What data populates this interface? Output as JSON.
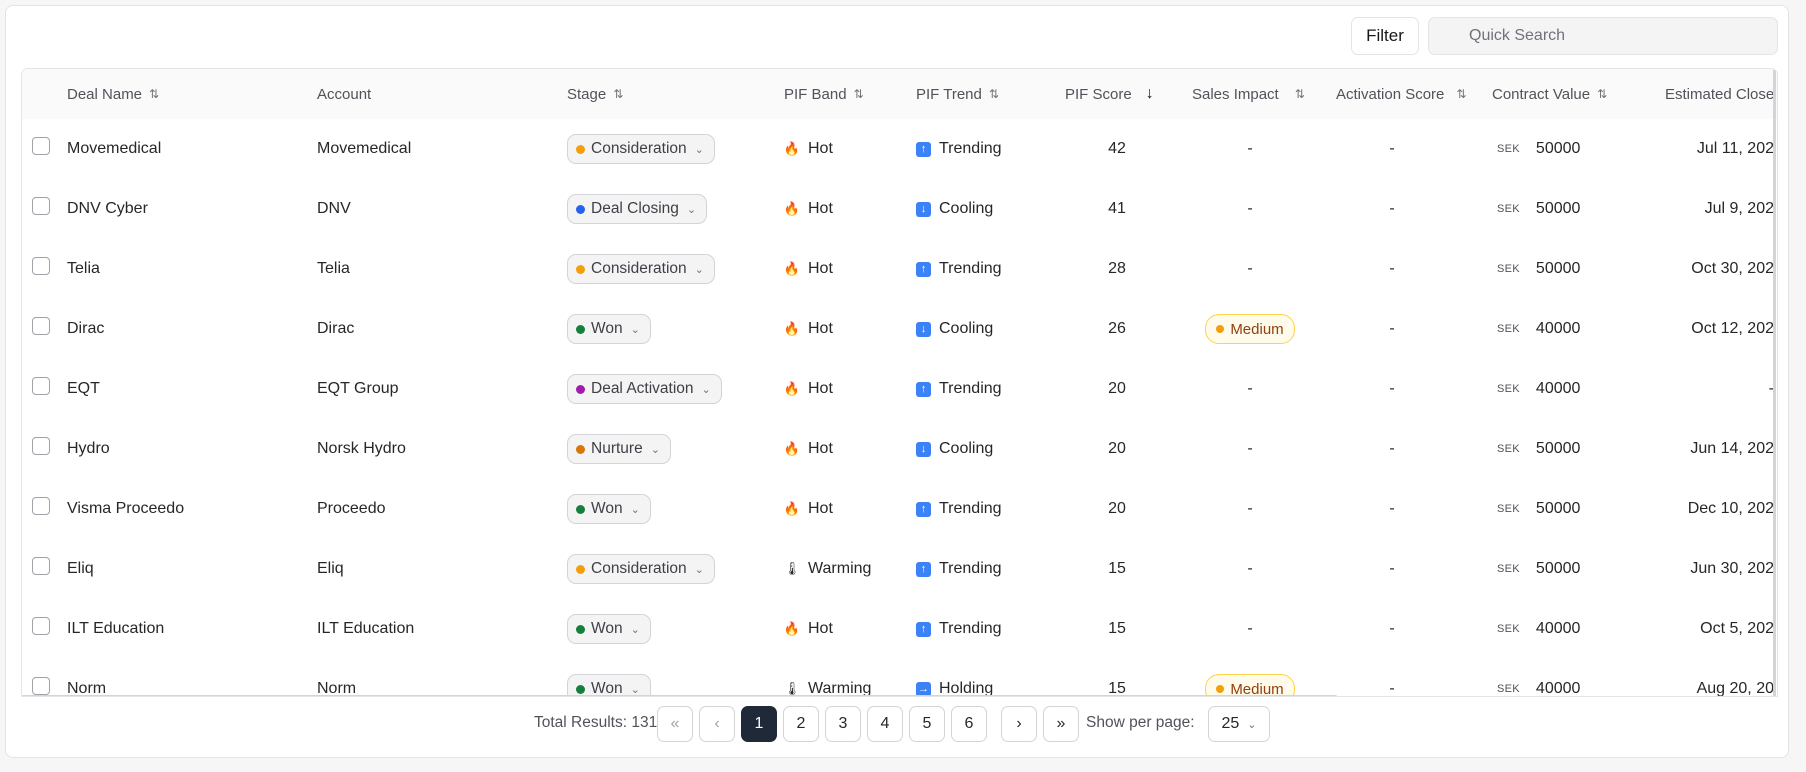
{
  "toolbar": {
    "filter_label": "Filter",
    "search_placeholder": "Quick Search",
    "search_value": ""
  },
  "columns": {
    "deal_name": "Deal Name",
    "account": "Account",
    "stage": "Stage",
    "pif_band": "PIF Band",
    "pif_trend": "PIF Trend",
    "pif_score": "PIF Score",
    "sales_impact": "Sales Impact",
    "activation_score": "Activation Score",
    "contract_value": "Contract Value",
    "estimated_close": "Estimated Close"
  },
  "stage_colors": {
    "Consideration": "#f59e0b",
    "Deal Closing": "#2563eb",
    "Won": "#15803d",
    "Deal Activation": "#a21caf",
    "Nurture": "#d97706"
  },
  "band_icons": {
    "Hot": "fire-icon",
    "Warming": "thermometer-icon"
  },
  "trend_icons": {
    "Trending": "arrow-up-icon",
    "Cooling": "arrow-down-icon",
    "Holding": "arrow-right-icon"
  },
  "rows": [
    {
      "deal": "Movemedical",
      "account": "Movemedical",
      "stage": "Consideration",
      "band": "Hot",
      "trend": "Trending",
      "score": "42",
      "impact": "-",
      "activation": "-",
      "currency": "SEK",
      "value": "50000",
      "close": "Jul 11, 202"
    },
    {
      "deal": "DNV Cyber",
      "account": "DNV",
      "stage": "Deal Closing",
      "band": "Hot",
      "trend": "Cooling",
      "score": "41",
      "impact": "-",
      "activation": "-",
      "currency": "SEK",
      "value": "50000",
      "close": "Jul 9, 202"
    },
    {
      "deal": "Telia",
      "account": "Telia",
      "stage": "Consideration",
      "band": "Hot",
      "trend": "Trending",
      "score": "28",
      "impact": "-",
      "activation": "-",
      "currency": "SEK",
      "value": "50000",
      "close": "Oct 30, 202"
    },
    {
      "deal": "Dirac",
      "account": "Dirac",
      "stage": "Won",
      "band": "Hot",
      "trend": "Cooling",
      "score": "26",
      "impact": "Medium",
      "activation": "-",
      "currency": "SEK",
      "value": "40000",
      "close": "Oct 12, 202"
    },
    {
      "deal": "EQT",
      "account": "EQT Group",
      "stage": "Deal Activation",
      "band": "Hot",
      "trend": "Trending",
      "score": "20",
      "impact": "-",
      "activation": "-",
      "currency": "SEK",
      "value": "40000",
      "close": "-"
    },
    {
      "deal": "Hydro",
      "account": "Norsk Hydro",
      "stage": "Nurture",
      "band": "Hot",
      "trend": "Cooling",
      "score": "20",
      "impact": "-",
      "activation": "-",
      "currency": "SEK",
      "value": "50000",
      "close": "Jun 14, 202"
    },
    {
      "deal": "Visma Proceedo",
      "account": "Proceedo",
      "stage": "Won",
      "band": "Hot",
      "trend": "Trending",
      "score": "20",
      "impact": "-",
      "activation": "-",
      "currency": "SEK",
      "value": "50000",
      "close": "Dec 10, 202"
    },
    {
      "deal": "Eliq",
      "account": "Eliq",
      "stage": "Consideration",
      "band": "Warming",
      "trend": "Trending",
      "score": "15",
      "impact": "-",
      "activation": "-",
      "currency": "SEK",
      "value": "50000",
      "close": "Jun 30, 202"
    },
    {
      "deal": "ILT Education",
      "account": "ILT Education",
      "stage": "Won",
      "band": "Hot",
      "trend": "Trending",
      "score": "15",
      "impact": "-",
      "activation": "-",
      "currency": "SEK",
      "value": "40000",
      "close": "Oct 5, 202"
    },
    {
      "deal": "Norm",
      "account": "Norm",
      "stage": "Won",
      "band": "Warming",
      "trend": "Holding",
      "score": "15",
      "impact": "Medium",
      "activation": "-",
      "currency": "SEK",
      "value": "40000",
      "close": "Aug 20, 20"
    }
  ],
  "footer": {
    "total_results": "Total Results: 131",
    "pages": [
      "1",
      "2",
      "3",
      "4",
      "5",
      "6"
    ],
    "current_page": "1",
    "show_per_page_label": "Show per page:",
    "per_page_value": "25"
  }
}
